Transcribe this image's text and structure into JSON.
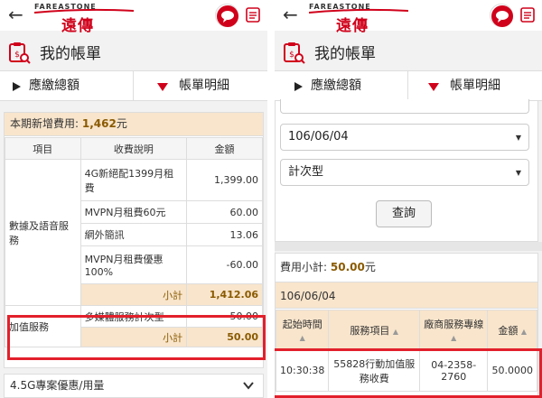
{
  "header": {
    "back_icon": "arrow-left-icon",
    "logo_top": "FAREASTONE",
    "logo_main": "遠傳",
    "chat_icon": "chat-bubble-icon",
    "menu_icon": "document-list-icon"
  },
  "title": {
    "icon": "bill-clipboard-icon",
    "text": "我的帳單"
  },
  "tabs": {
    "summary": "應繳總額",
    "detail": "帳單明細",
    "summary_icon": "triangle-right-icon",
    "detail_icon": "triangle-down-icon"
  },
  "left": {
    "summary_label": "本期新增費用:",
    "summary_amount": "1,462",
    "summary_unit": "元",
    "columns": [
      "項目",
      "收費說明",
      "金額"
    ],
    "group1": {
      "name": "數據及語音服務",
      "rows": [
        {
          "desc": "4G新絕配1399月租費",
          "amount": "1,399.00"
        },
        {
          "desc": "MVPN月租費60元",
          "amount": "60.00"
        },
        {
          "desc": "網外簡訊",
          "amount": "13.06"
        },
        {
          "desc": "MVPN月租費優惠100%",
          "amount": "-60.00"
        }
      ],
      "subtotal_label": "小計",
      "subtotal": "1,412.06"
    },
    "group2": {
      "name": "加值服務",
      "rows": [
        {
          "desc": "多媒體服務計次型",
          "amount": "50.00"
        }
      ],
      "subtotal_label": "小計",
      "subtotal": "50.00"
    },
    "collapse_label": "4.5G專案優惠/用量",
    "collapse_icon": "chevron-down-icon"
  },
  "right": {
    "select_date": "106/06/04",
    "select_type": "計次型",
    "caret_icon": "caret-down-icon",
    "query_label": "查詢",
    "subtotal_label": "費用小計:",
    "subtotal_amount": "50.00",
    "subtotal_unit": "元",
    "date_header": "106/06/04",
    "columns": [
      "起始時間",
      "服務項目",
      "廠商服務專線",
      "金額"
    ],
    "sort_icon": "sort-up-icon",
    "rows": [
      {
        "time": "10:30:38",
        "item": "55828行動加值服務收費",
        "line": "04-2358-2760",
        "amount": "50.0000"
      }
    ]
  },
  "colors": {
    "brand_red": "#d0021b",
    "highlight_red": "#e2202b",
    "summary_bg": "#f8e5cc"
  }
}
